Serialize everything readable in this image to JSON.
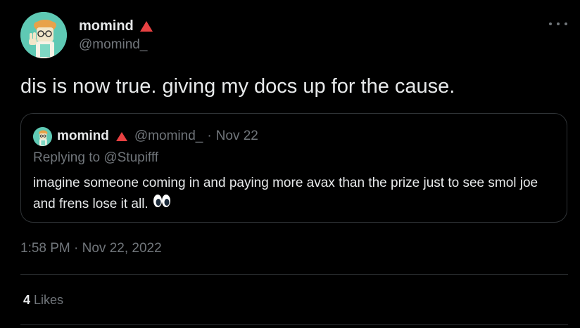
{
  "author": {
    "display_name": "momind",
    "handle": "@momind_",
    "badge_color": "#e84142"
  },
  "tweet": {
    "text": "dis is now true. giving my docs up for the cause.",
    "timestamp": "1:58 PM · Nov 22, 2022",
    "likes_count": "4",
    "likes_label": "Likes"
  },
  "quoted_tweet": {
    "display_name": "momind",
    "handle": "@momind_",
    "separator": "·",
    "date": "Nov 22",
    "replying_to": "Replying to @Stupifff",
    "text": "imagine someone coming in and paying more avax than the prize just to see smol joe and frens lose it all.",
    "emoji": "eyes-emoji"
  },
  "icons": {
    "more": "more-options-icon",
    "badge": "avalanche-triangle-icon"
  },
  "colors": {
    "background": "#000000",
    "text_primary": "#e7e9ea",
    "text_secondary": "#71767b",
    "border": "#2f3336",
    "avatar_bg": "#5fc9b4"
  }
}
